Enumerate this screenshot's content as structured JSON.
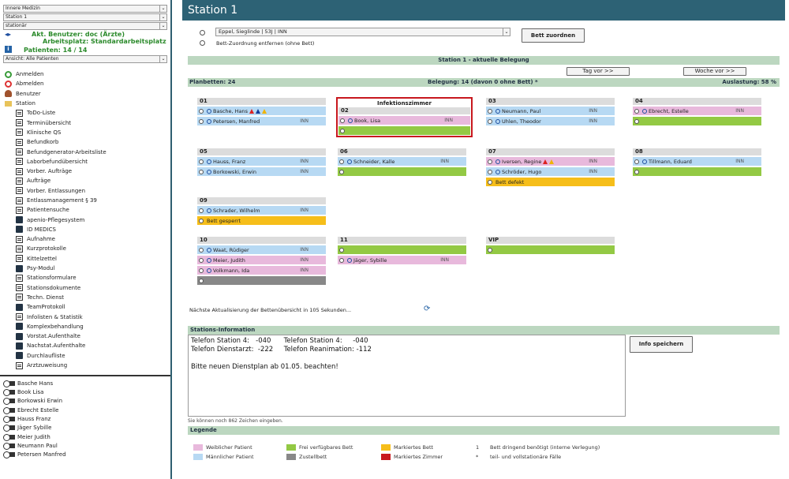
{
  "sidebar": {
    "selects": [
      "Innere Medizin",
      "Station 1",
      "stationär"
    ],
    "user_line1": "Akt. Benutzer: doc (Ärzte)",
    "user_line2": "Arbeitsplatz: Standardarbeitsplatz",
    "patients_line": "Patienten: 14 / 14",
    "view_select": "Ansicht: Alle Patienten",
    "top_items": [
      "Anmelden",
      "Abmelden",
      "Benutzer",
      "Station"
    ],
    "sub_items": [
      "ToDo-Liste",
      "Terminübersicht",
      "Klinische QS",
      "Befundkorb",
      "Befundgenerator-Arbeitsliste",
      "Laborbefundübersicht",
      "Vorber. Aufträge",
      "Aufträge",
      "Vorber. Entlassungen",
      "Entlassmanagement § 39",
      "Patientensuche",
      "apenio-Pflegesystem",
      "ID MEDICS",
      "Aufnahme",
      "Kurzprotokolle",
      "Kittelzettel",
      "Psy-Modul",
      "Stationsformulare",
      "Stationsdokumente",
      "Techn. Dienst",
      "TeamProtokoll",
      "Infolisten & Statistik",
      "Komplexbehandlung",
      "Vorstat.Aufenthalte",
      "Nachstat.Aufenthalte",
      "Durchlaufliste",
      "Arztzuweisung"
    ],
    "patients": [
      "Basche Hans",
      "Book Lisa",
      "Borkowski Erwin",
      "Ebrecht Estelle",
      "Hauss Franz",
      "Jäger Sybille",
      "Meier Judith",
      "Neumann Paul",
      "Petersen Manfred"
    ]
  },
  "main": {
    "title": "Station 1",
    "assign_select": "Eppel, Sieglinde | 53J | INN",
    "assign_remove": "Bett-Zuordnung entfernen (ohne Bett)",
    "assign_button": "Bett zuordnen",
    "occupancy_header": "Station 1 - aktuelle Belegung",
    "day_button": "Tag vor >>",
    "week_button": "Woche vor >>",
    "plan_beds": "Planbetten: 24",
    "occupancy": "Belegung: 14 (davon 0 ohne Bett) *",
    "utilization": "Auslastung: 58 %",
    "refresh_text": "Nächste Aktualisierung der Bettenübersicht in 105 Sekunden...",
    "info_header": "Stations-Information",
    "info_text": "Telefon Station 4:   -040      Telefon Station 4:     -040\nTelefon Dienstarzt:  -222     Telefon Reanimation: -112\n\nBitte neuen Dienstplan ab 01.05. beachten!",
    "chars_left": "Sie können noch 862 Zeichen eingeben.",
    "save_button": "Info speichern",
    "legend_header": "Legende"
  },
  "rooms": [
    {
      "id": "01",
      "beds": [
        {
          "name": "Basche, Hans",
          "ins": "",
          "type": "male"
        },
        {
          "name": "Petersen, Manfred",
          "ins": "INN",
          "type": "male"
        }
      ]
    },
    {
      "id": "02",
      "tag": "Infektionszimmer",
      "beds": [
        {
          "name": "Book, Lisa",
          "ins": "INN",
          "type": "female"
        },
        {
          "name": "",
          "ins": "",
          "type": "free"
        }
      ]
    },
    {
      "id": "03",
      "beds": [
        {
          "name": "Neumann, Paul",
          "ins": "INN",
          "type": "male"
        },
        {
          "name": "Uhlen, Theodor",
          "ins": "INN",
          "type": "male"
        }
      ]
    },
    {
      "id": "04",
      "beds": [
        {
          "name": "Ebrecht, Estelle",
          "ins": "INN",
          "type": "female"
        },
        {
          "name": "",
          "ins": "",
          "type": "free"
        }
      ]
    },
    {
      "id": "05",
      "beds": [
        {
          "name": "Hauss, Franz",
          "ins": "INN",
          "type": "male"
        },
        {
          "name": "Borkowski, Erwin",
          "ins": "INN",
          "type": "male"
        }
      ]
    },
    {
      "id": "06",
      "beds": [
        {
          "name": "Schneider, Kalle",
          "ins": "INN",
          "type": "male"
        },
        {
          "name": "",
          "ins": "",
          "type": "free"
        }
      ]
    },
    {
      "id": "07",
      "beds": [
        {
          "name": "Iversen, Regine",
          "ins": "INN",
          "type": "female"
        },
        {
          "name": "Schröder, Hugo",
          "ins": "INN",
          "type": "male"
        },
        {
          "name": "Bett defekt",
          "ins": "",
          "type": "marked"
        }
      ]
    },
    {
      "id": "08",
      "beds": [
        {
          "name": "Tillmann, Eduard",
          "ins": "INN",
          "type": "male"
        },
        {
          "name": "",
          "ins": "",
          "type": "free"
        }
      ]
    },
    {
      "id": "09",
      "beds": [
        {
          "name": "Schrader, Wilhelm",
          "ins": "INN",
          "type": "male"
        },
        {
          "name": "Bett gesperrt",
          "ins": "",
          "type": "marked"
        }
      ]
    },
    {
      "id": "10",
      "beds": [
        {
          "name": "Waat, Rüdiger",
          "ins": "INN",
          "type": "male"
        },
        {
          "name": "Meier, Judith",
          "ins": "INN",
          "type": "female"
        },
        {
          "name": "Volkmann, Ida",
          "ins": "INN",
          "type": "female"
        },
        {
          "name": "",
          "ins": "",
          "type": "gray"
        }
      ]
    },
    {
      "id": "11",
      "beds": [
        {
          "name": "",
          "ins": "",
          "type": "free"
        },
        {
          "name": "Jäger, Sybille",
          "ins": "INN",
          "type": "female"
        }
      ]
    },
    {
      "id": "VIP",
      "beds": [
        {
          "name": "",
          "ins": "",
          "type": "free"
        }
      ]
    }
  ],
  "legend": [
    {
      "label": "Weiblicher Patient",
      "color": "#e8b9dc"
    },
    {
      "label": "Männlicher Patient",
      "color": "#b7d9f3"
    },
    {
      "label": "Frei verfügbares Bett",
      "color": "#93c944"
    },
    {
      "label": "Zustellbett",
      "color": "#888888"
    },
    {
      "label": "Markiertes Bett",
      "color": "#f6be1a"
    },
    {
      "label": "Markiertes Zimmer",
      "color": "#c8181e"
    },
    {
      "label": "Bett dringend benötigt (interne Verlegung)",
      "key": "1"
    },
    {
      "label": "teil- und vollstationäre Fälle",
      "key": "*"
    }
  ]
}
